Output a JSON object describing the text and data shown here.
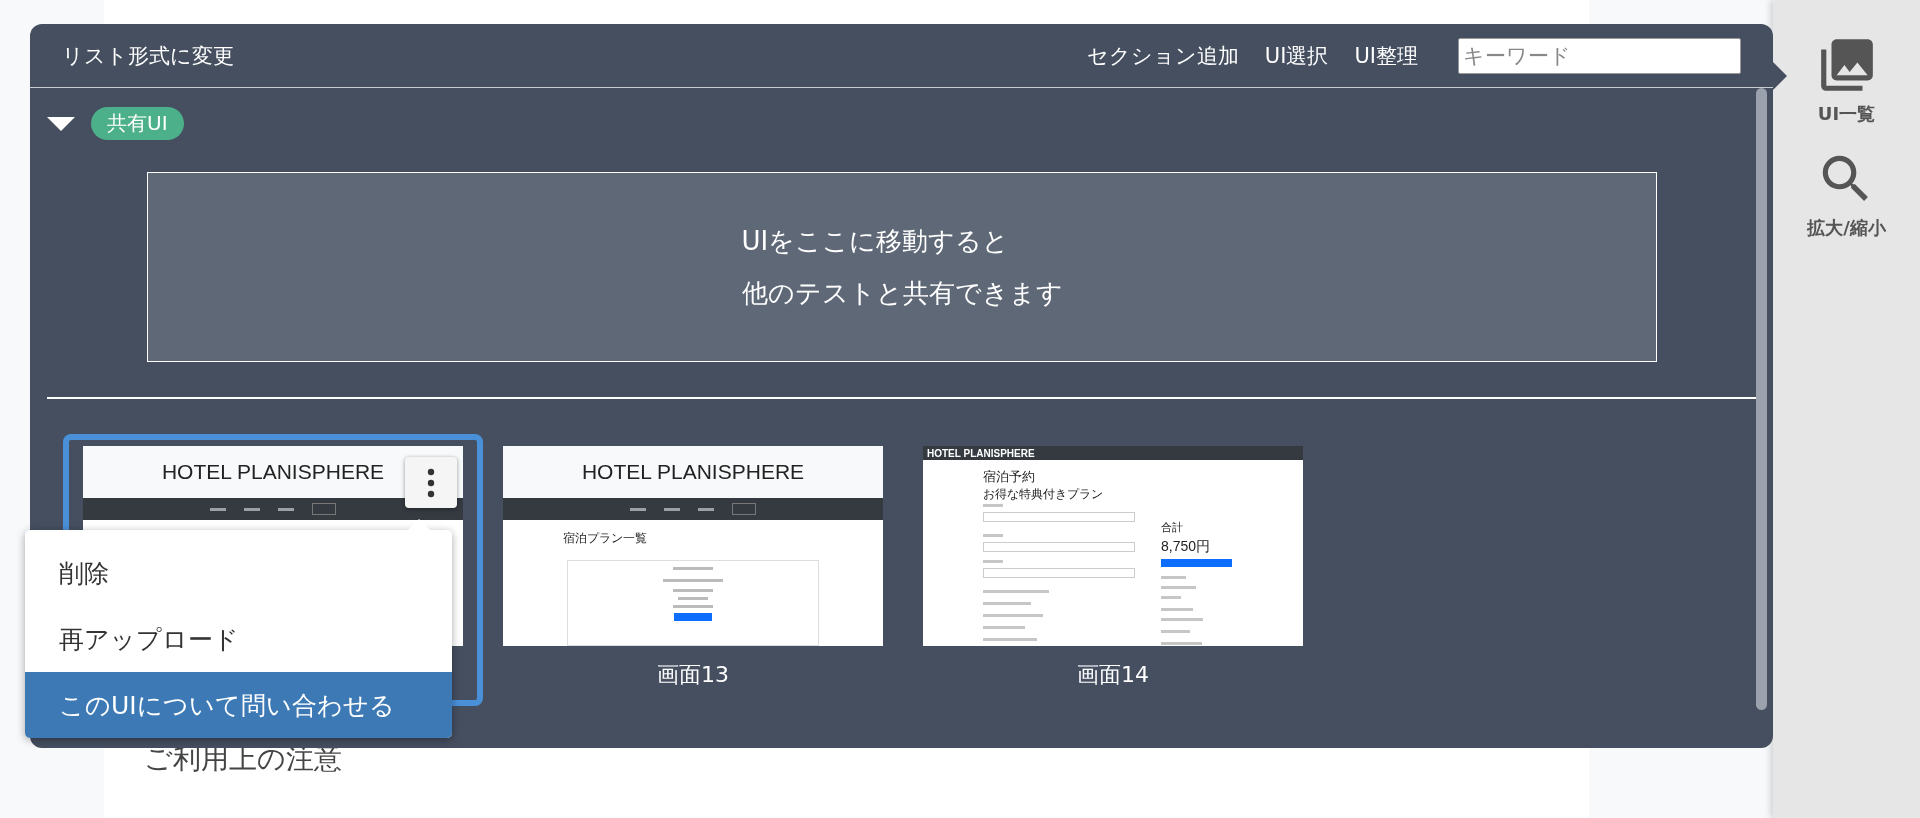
{
  "toolbar": {
    "view_toggle": "リスト形式に変更",
    "actions": [
      "セクション追加",
      "UI選択",
      "UI整理"
    ],
    "search": {
      "placeholder": "キーワード"
    }
  },
  "section": {
    "expanded": true,
    "badge": "共有UI",
    "dropzone_lines": [
      "UIをここに移動すると",
      "他のテストと共有できます"
    ]
  },
  "screens": [
    {
      "kind": "home",
      "selected": true,
      "title": "HOTEL PLANISPHERE"
    },
    {
      "kind": "plans",
      "selected": false,
      "title": "HOTEL PLANISPHERE",
      "heading": "宿泊プラン一覧",
      "label": "画面13"
    },
    {
      "kind": "reserve",
      "selected": false,
      "title": "HOTEL PLANISPHERE",
      "heading": "宿泊予約",
      "plan": "お得な特典付きプラン",
      "total_label": "合計",
      "total": "8,750円",
      "label": "画面14"
    }
  ],
  "context_menu": {
    "items": [
      {
        "label": "削除",
        "selected": false
      },
      {
        "label": "再アップロード",
        "selected": false
      },
      {
        "label": "このUIについて問い合わせる",
        "selected": true
      }
    ]
  },
  "sidebar": {
    "items": [
      {
        "kind": "gallery",
        "label": "UI一覧"
      },
      {
        "kind": "zoom",
        "label": "拡大/縮小"
      }
    ]
  },
  "page": {
    "heading": "ご利用上の注意"
  }
}
